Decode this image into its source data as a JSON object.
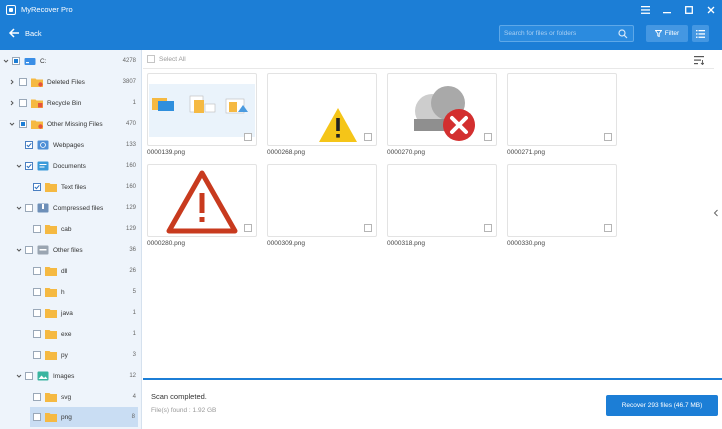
{
  "app": {
    "title": "MyRecover Pro"
  },
  "toolbar": {
    "back_label": "Back",
    "search_placeholder": "Search for files or folders",
    "filter_label": "Filter"
  },
  "tree": [
    {
      "label": "C:",
      "count": "4278"
    },
    {
      "label": "Deleted Files",
      "count": "3807"
    },
    {
      "label": "Recycle Bin",
      "count": "1"
    },
    {
      "label": "Other Missing Files",
      "count": "470"
    },
    {
      "label": "Webpages",
      "count": "133"
    },
    {
      "label": "Documents",
      "count": "160"
    },
    {
      "label": "Text files",
      "count": "160"
    },
    {
      "label": "Compressed files",
      "count": "129"
    },
    {
      "label": "cab",
      "count": "129"
    },
    {
      "label": "Other files",
      "count": "36"
    },
    {
      "label": "dll",
      "count": "26"
    },
    {
      "label": "h",
      "count": "5"
    },
    {
      "label": "java",
      "count": "1"
    },
    {
      "label": "exe",
      "count": "1"
    },
    {
      "label": "py",
      "count": "3"
    },
    {
      "label": "Images",
      "count": "12"
    },
    {
      "label": "svg",
      "count": "4"
    },
    {
      "label": "png",
      "count": "8"
    }
  ],
  "content": {
    "select_all_label": "Select All",
    "files": [
      {
        "name": "0000139.png"
      },
      {
        "name": "0000268.png"
      },
      {
        "name": "0000270.png"
      },
      {
        "name": "0000271.png"
      },
      {
        "name": "0000280.png"
      },
      {
        "name": "0000309.png"
      },
      {
        "name": "0000318.png"
      },
      {
        "name": "0000330.png"
      }
    ]
  },
  "footer": {
    "status": "Scan completed.",
    "found": "File(s) found : 1.92 GB",
    "recover_label": "Recover 293 files (46.7 MB)"
  },
  "colors": {
    "primary": "#1c7ed6",
    "folder": "#f5b942",
    "warning_yellow": "#f5c518",
    "error_red": "#d32f2f",
    "alert_orange_red": "#c83a1e"
  }
}
